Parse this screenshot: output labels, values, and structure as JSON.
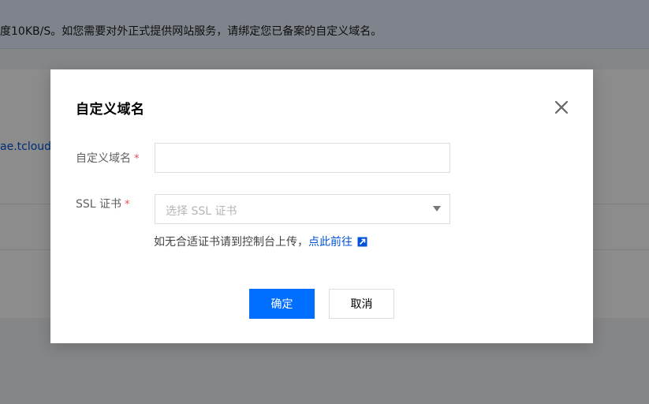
{
  "background": {
    "notice_text": "度10KB/S。如您需要对外正式提供网站服务，请绑定您已备案的自定义域名。",
    "domain_link_fragment": "ae.tcloudb"
  },
  "dialog": {
    "title": "自定义域名",
    "close_icon": "close-icon",
    "domain_field": {
      "label": "自定义域名",
      "required_mark": "*",
      "value": "",
      "placeholder": ""
    },
    "ssl_field": {
      "label": "SSL 证书",
      "required_mark": "*",
      "placeholder": "选择 SSL 证书"
    },
    "hint": {
      "text": "如无合适证书请到控制台上传，",
      "link_text": "点此前往",
      "link_icon": "external-link-icon"
    },
    "confirm_label": "确定",
    "cancel_label": "取消"
  },
  "colors": {
    "primary": "#006eff",
    "link": "#0052d9",
    "required": "#e34d59",
    "mask": "rgba(0,0,0,0.45)"
  }
}
